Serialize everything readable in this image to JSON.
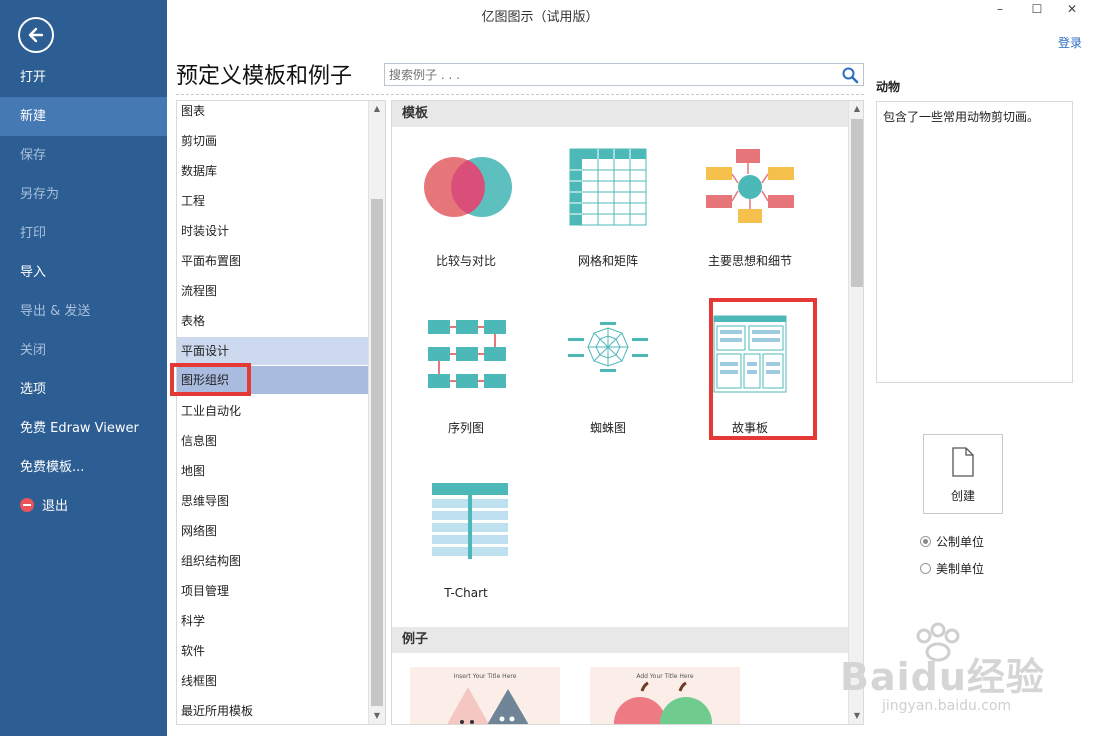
{
  "app": {
    "title": "亿图图示（试用版）",
    "login": "登录"
  },
  "window_controls": {
    "minimize": "–",
    "maximize": "☐",
    "close": "✕"
  },
  "sidebar": {
    "items": [
      {
        "label": "打开",
        "state": "normal"
      },
      {
        "label": "新建",
        "state": "active"
      },
      {
        "label": "保存",
        "state": "disabled"
      },
      {
        "label": "另存为",
        "state": "disabled"
      },
      {
        "label": "打印",
        "state": "disabled"
      },
      {
        "label": "导入",
        "state": "normal"
      },
      {
        "label": "导出 & 发送",
        "state": "disabled"
      },
      {
        "label": "关闭",
        "state": "disabled"
      },
      {
        "label": "选项",
        "state": "normal"
      },
      {
        "label": "免费 Edraw Viewer",
        "state": "normal"
      },
      {
        "label": "免费模板...",
        "state": "normal"
      },
      {
        "label": "退出",
        "state": "normal",
        "icon": "exit-icon"
      }
    ]
  },
  "main": {
    "title": "预定义模板和例子",
    "search": {
      "placeholder": "搜索例子 . . ."
    }
  },
  "categories": [
    "图表",
    "剪切画",
    "数据库",
    "工程",
    "时装设计",
    "平面布置图",
    "流程图",
    "表格",
    "平面设计",
    "图形组织",
    "工业自动化",
    "信息图",
    "地图",
    "思维导图",
    "网络图",
    "组织结构图",
    "项目管理",
    "科学",
    "软件",
    "线框图",
    "最近所用模板"
  ],
  "selected_categories": {
    "hover": "平面设计",
    "selected": "图形组织"
  },
  "templates": {
    "header": "模板",
    "items": [
      "比较与对比",
      "网格和矩阵",
      "主要思想和细节",
      "序列图",
      "蜘蛛图",
      "故事板",
      "T-Chart"
    ]
  },
  "examples": {
    "header": "例子",
    "items": [
      "Insert Your Title Here",
      "Add Your Title Here"
    ]
  },
  "right_panel": {
    "title": "动物",
    "description": "包含了一些常用动物剪切画。",
    "create_label": "创建",
    "units": [
      {
        "label": "公制单位",
        "checked": true
      },
      {
        "label": "美制单位",
        "checked": false
      }
    ]
  },
  "watermark": {
    "text": "Baidu经验",
    "url_text": "jingyan.baidu.com"
  },
  "colors": {
    "sidebar": "#2c5d93",
    "sidebar_active": "#4579b4",
    "highlight": "#e53935",
    "teal": "#4db8b8",
    "coral": "#e7767a"
  }
}
